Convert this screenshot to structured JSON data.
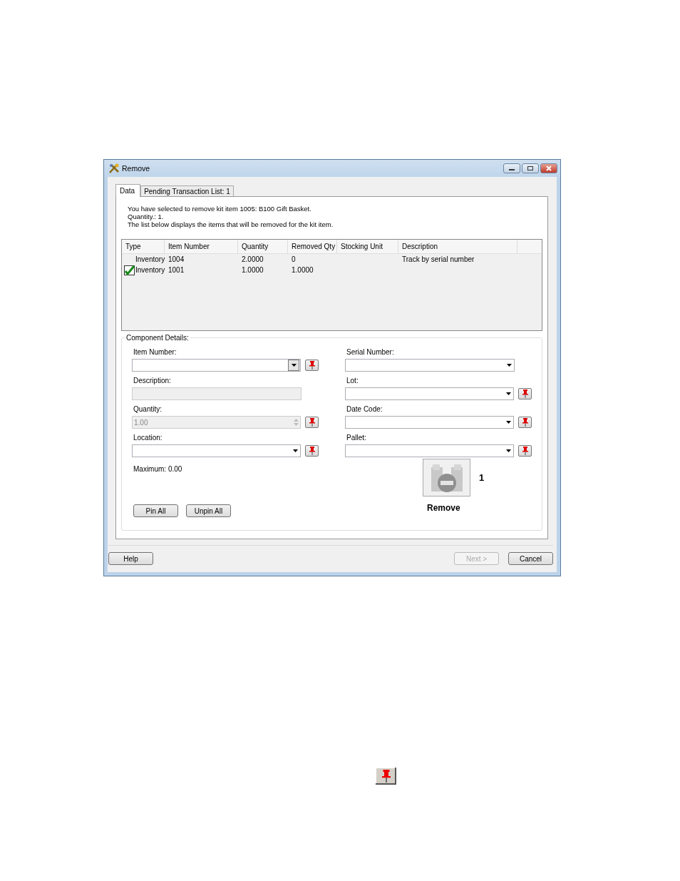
{
  "window": {
    "title": "Remove"
  },
  "tabs": [
    {
      "label": "Data",
      "selected": true
    },
    {
      "label": "Pending Transaction List: 1",
      "selected": false
    }
  ],
  "intro": [
    "You have selected to remove kit item 1005:  B100 Gift Basket.",
    "Quantity.: 1.",
    "The list below displays the items that will be removed for the kit item."
  ],
  "table": {
    "columns": [
      "Type",
      "Item Number",
      "Quantity",
      "Removed Qty",
      "Stocking Unit",
      "Description"
    ],
    "rows": [
      {
        "checked": false,
        "cells": [
          "Inventory",
          "1004",
          "2.0000",
          "0",
          null,
          "Track by serial number"
        ]
      },
      {
        "checked": true,
        "cells": [
          "Inventory",
          "1001",
          "1.0000",
          "1.0000",
          null,
          null
        ]
      }
    ]
  },
  "component_details": {
    "title": "Component Details:",
    "left": [
      {
        "label": "Item Number:",
        "kind": "combo",
        "disabled": false,
        "pin": true
      },
      {
        "label": "Description:",
        "kind": "text",
        "disabled": true,
        "pin": false
      },
      {
        "label": "Quantity:",
        "kind": "spin",
        "value": "1.00",
        "disabled": true,
        "pin": true
      },
      {
        "label": "Location:",
        "kind": "combo",
        "disabled": false,
        "pin": true
      }
    ],
    "right": [
      {
        "label": "Serial Number:",
        "kind": "combo",
        "disabled": false,
        "pin": false
      },
      {
        "label": "Lot:",
        "kind": "combo",
        "disabled": false,
        "pin": true
      },
      {
        "label": "Date Code:",
        "kind": "combo",
        "disabled": false,
        "pin": true
      },
      {
        "label": "Pallet:",
        "kind": "combo",
        "disabled": false,
        "pin": true
      }
    ],
    "maximum": "Maximum: 0.00",
    "buttons": [
      "Pin All",
      "Unpin All"
    ],
    "remove": {
      "label": "Remove",
      "count": "1"
    }
  },
  "footer": {
    "buttons": [
      {
        "label": "Help",
        "disabled": false
      },
      {
        "label": "Next >",
        "disabled": true
      },
      {
        "label": "Cancel",
        "disabled": false
      }
    ]
  }
}
